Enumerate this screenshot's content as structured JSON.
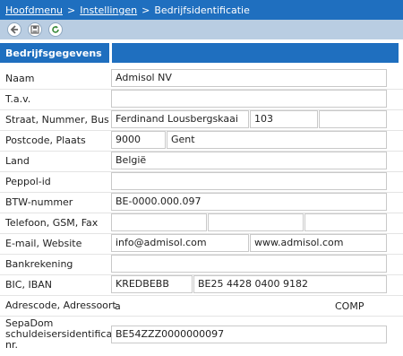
{
  "breadcrumb": {
    "items": [
      "Hoofdmenu",
      "Instellingen",
      "Bedrijfsidentificatie"
    ],
    "separator": ">"
  },
  "toolbar": {
    "buttons": [
      "back-icon",
      "save-icon",
      "refresh-icon"
    ]
  },
  "section": {
    "title": "Bedrijfsgegevens"
  },
  "form": {
    "naam": {
      "label": "Naam",
      "value": "Admisol NV"
    },
    "tav": {
      "label": "T.a.v.",
      "value": ""
    },
    "straat": {
      "label": "Straat, Nummer, Bus",
      "street": "Ferdinand Lousbergskaai",
      "number": "103",
      "bus": ""
    },
    "postcode": {
      "label": "Postcode, Plaats",
      "postcode": "9000",
      "plaats": "Gent"
    },
    "land": {
      "label": "Land",
      "value": "België"
    },
    "peppol": {
      "label": "Peppol-id",
      "value": ""
    },
    "btw": {
      "label": "BTW-nummer",
      "value": "BE-0000.000.097"
    },
    "telefoon": {
      "label": "Telefoon, GSM, Fax",
      "telefoon": "",
      "gsm": "",
      "fax": ""
    },
    "email": {
      "label": "E-mail, Website",
      "email": "info@admisol.com",
      "website": "www.admisol.com"
    },
    "bank": {
      "label": "Bankrekening",
      "value": ""
    },
    "bic": {
      "label": "BIC, IBAN",
      "bic": "KREDBEBB",
      "iban": "BE25 4428 0400 9182"
    },
    "adrescode": {
      "label": "Adrescode, Adressoort",
      "code": "a",
      "soort": "COMP"
    },
    "sepa": {
      "label_line1": "SepaDom",
      "label_line2": "schuldeisersidentificatie",
      "label_line3": "nr.",
      "value": "BE54ZZZ0000000097"
    }
  },
  "colors": {
    "accent": "#1f6fbf",
    "toolbar": "#b9cde2"
  }
}
